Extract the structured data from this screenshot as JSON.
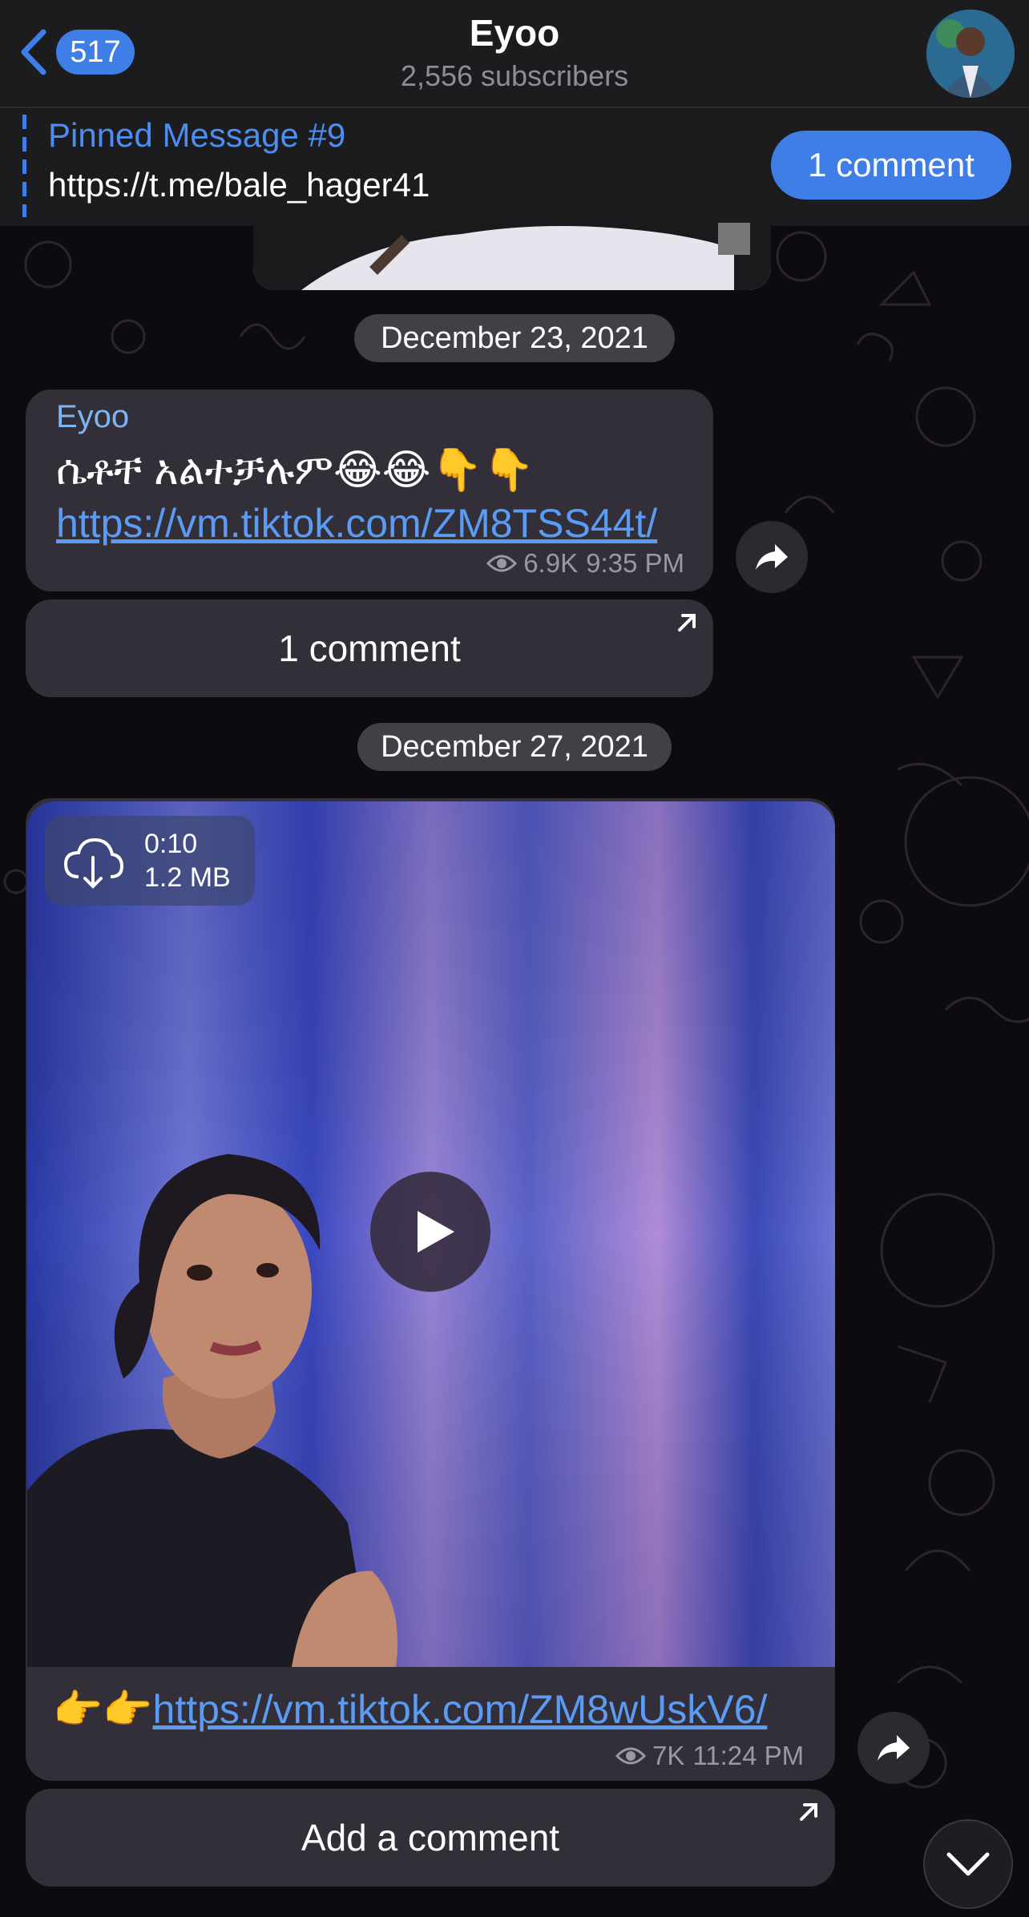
{
  "header": {
    "back_count": "517",
    "title": "Eyoo",
    "subtitle": "2,556 subscribers"
  },
  "pinned": {
    "title": "Pinned Message #9",
    "text": "https://t.me/bale_hager41",
    "button": "1 comment"
  },
  "messages": [
    {
      "date": "December 23, 2021",
      "sender": "Eyoo",
      "text": "ሴቶቸ አልተቻሉም😂😂👇👇",
      "link": "https://vm.tiktok.com/ZM8TSS44t/",
      "views": "6.9K",
      "time": "9:35 PM",
      "comment_label": "1 comment"
    },
    {
      "date": "December 27, 2021",
      "video_duration": "0:10",
      "video_size": "1.2 MB",
      "prefix": "👉👉",
      "link": "https://vm.tiktok.com/ZM8wUskV6/",
      "views": "7K",
      "time": "11:24 PM",
      "comment_label": "Add a comment"
    }
  ],
  "colors": {
    "accent": "#3e7ee6",
    "bubble": "#332f39",
    "background": "#0d0b10"
  }
}
